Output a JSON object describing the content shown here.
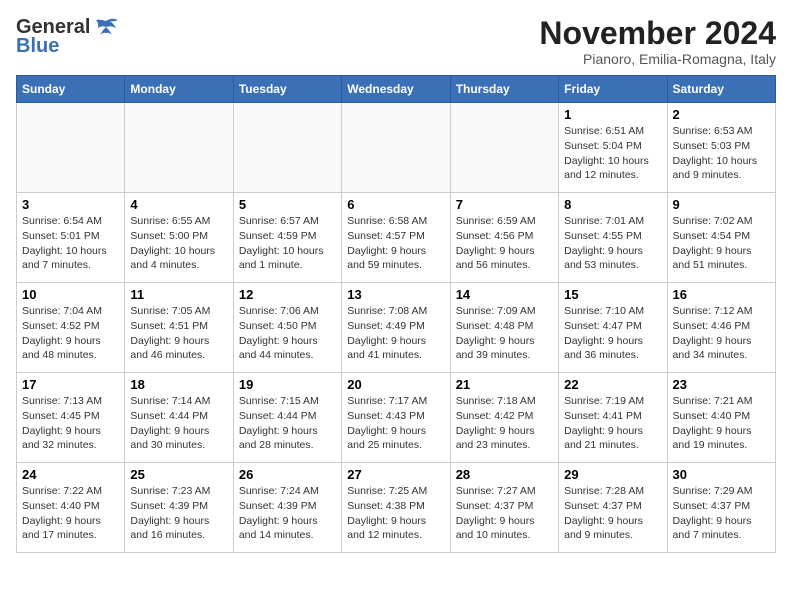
{
  "header": {
    "logo_general": "General",
    "logo_blue": "Blue",
    "month_title": "November 2024",
    "location": "Pianoro, Emilia-Romagna, Italy"
  },
  "weekdays": [
    "Sunday",
    "Monday",
    "Tuesday",
    "Wednesday",
    "Thursday",
    "Friday",
    "Saturday"
  ],
  "weeks": [
    [
      {
        "day": "",
        "detail": ""
      },
      {
        "day": "",
        "detail": ""
      },
      {
        "day": "",
        "detail": ""
      },
      {
        "day": "",
        "detail": ""
      },
      {
        "day": "",
        "detail": ""
      },
      {
        "day": "1",
        "detail": "Sunrise: 6:51 AM\nSunset: 5:04 PM\nDaylight: 10 hours and 12 minutes."
      },
      {
        "day": "2",
        "detail": "Sunrise: 6:53 AM\nSunset: 5:03 PM\nDaylight: 10 hours and 9 minutes."
      }
    ],
    [
      {
        "day": "3",
        "detail": "Sunrise: 6:54 AM\nSunset: 5:01 PM\nDaylight: 10 hours and 7 minutes."
      },
      {
        "day": "4",
        "detail": "Sunrise: 6:55 AM\nSunset: 5:00 PM\nDaylight: 10 hours and 4 minutes."
      },
      {
        "day": "5",
        "detail": "Sunrise: 6:57 AM\nSunset: 4:59 PM\nDaylight: 10 hours and 1 minute."
      },
      {
        "day": "6",
        "detail": "Sunrise: 6:58 AM\nSunset: 4:57 PM\nDaylight: 9 hours and 59 minutes."
      },
      {
        "day": "7",
        "detail": "Sunrise: 6:59 AM\nSunset: 4:56 PM\nDaylight: 9 hours and 56 minutes."
      },
      {
        "day": "8",
        "detail": "Sunrise: 7:01 AM\nSunset: 4:55 PM\nDaylight: 9 hours and 53 minutes."
      },
      {
        "day": "9",
        "detail": "Sunrise: 7:02 AM\nSunset: 4:54 PM\nDaylight: 9 hours and 51 minutes."
      }
    ],
    [
      {
        "day": "10",
        "detail": "Sunrise: 7:04 AM\nSunset: 4:52 PM\nDaylight: 9 hours and 48 minutes."
      },
      {
        "day": "11",
        "detail": "Sunrise: 7:05 AM\nSunset: 4:51 PM\nDaylight: 9 hours and 46 minutes."
      },
      {
        "day": "12",
        "detail": "Sunrise: 7:06 AM\nSunset: 4:50 PM\nDaylight: 9 hours and 44 minutes."
      },
      {
        "day": "13",
        "detail": "Sunrise: 7:08 AM\nSunset: 4:49 PM\nDaylight: 9 hours and 41 minutes."
      },
      {
        "day": "14",
        "detail": "Sunrise: 7:09 AM\nSunset: 4:48 PM\nDaylight: 9 hours and 39 minutes."
      },
      {
        "day": "15",
        "detail": "Sunrise: 7:10 AM\nSunset: 4:47 PM\nDaylight: 9 hours and 36 minutes."
      },
      {
        "day": "16",
        "detail": "Sunrise: 7:12 AM\nSunset: 4:46 PM\nDaylight: 9 hours and 34 minutes."
      }
    ],
    [
      {
        "day": "17",
        "detail": "Sunrise: 7:13 AM\nSunset: 4:45 PM\nDaylight: 9 hours and 32 minutes."
      },
      {
        "day": "18",
        "detail": "Sunrise: 7:14 AM\nSunset: 4:44 PM\nDaylight: 9 hours and 30 minutes."
      },
      {
        "day": "19",
        "detail": "Sunrise: 7:15 AM\nSunset: 4:44 PM\nDaylight: 9 hours and 28 minutes."
      },
      {
        "day": "20",
        "detail": "Sunrise: 7:17 AM\nSunset: 4:43 PM\nDaylight: 9 hours and 25 minutes."
      },
      {
        "day": "21",
        "detail": "Sunrise: 7:18 AM\nSunset: 4:42 PM\nDaylight: 9 hours and 23 minutes."
      },
      {
        "day": "22",
        "detail": "Sunrise: 7:19 AM\nSunset: 4:41 PM\nDaylight: 9 hours and 21 minutes."
      },
      {
        "day": "23",
        "detail": "Sunrise: 7:21 AM\nSunset: 4:40 PM\nDaylight: 9 hours and 19 minutes."
      }
    ],
    [
      {
        "day": "24",
        "detail": "Sunrise: 7:22 AM\nSunset: 4:40 PM\nDaylight: 9 hours and 17 minutes."
      },
      {
        "day": "25",
        "detail": "Sunrise: 7:23 AM\nSunset: 4:39 PM\nDaylight: 9 hours and 16 minutes."
      },
      {
        "day": "26",
        "detail": "Sunrise: 7:24 AM\nSunset: 4:39 PM\nDaylight: 9 hours and 14 minutes."
      },
      {
        "day": "27",
        "detail": "Sunrise: 7:25 AM\nSunset: 4:38 PM\nDaylight: 9 hours and 12 minutes."
      },
      {
        "day": "28",
        "detail": "Sunrise: 7:27 AM\nSunset: 4:37 PM\nDaylight: 9 hours and 10 minutes."
      },
      {
        "day": "29",
        "detail": "Sunrise: 7:28 AM\nSunset: 4:37 PM\nDaylight: 9 hours and 9 minutes."
      },
      {
        "day": "30",
        "detail": "Sunrise: 7:29 AM\nSunset: 4:37 PM\nDaylight: 9 hours and 7 minutes."
      }
    ]
  ]
}
